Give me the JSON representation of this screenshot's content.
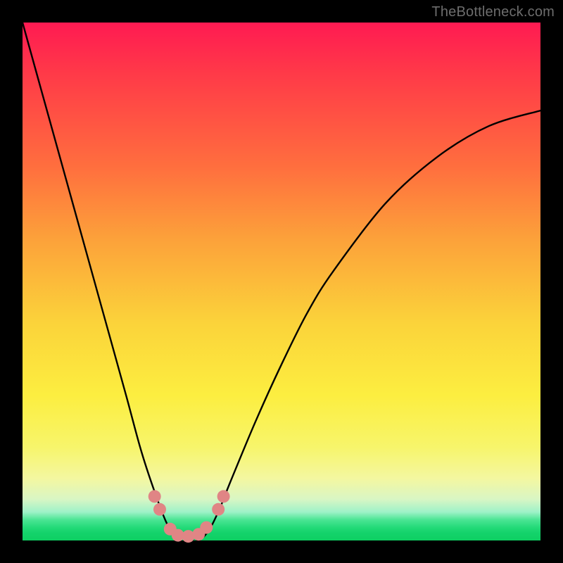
{
  "watermark": "TheBottleneck.com",
  "chart_data": {
    "type": "line",
    "title": "",
    "xlabel": "",
    "ylabel": "",
    "xlim": [
      0,
      1
    ],
    "ylim": [
      0,
      1
    ],
    "series": [
      {
        "name": "bottleneck-curve",
        "x": [
          0.0,
          0.05,
          0.1,
          0.15,
          0.2,
          0.23,
          0.26,
          0.28,
          0.3,
          0.32,
          0.34,
          0.36,
          0.38,
          0.4,
          0.45,
          0.5,
          0.55,
          0.6,
          0.7,
          0.8,
          0.9,
          1.0
        ],
        "y": [
          1.0,
          0.82,
          0.64,
          0.46,
          0.28,
          0.17,
          0.08,
          0.03,
          0.0,
          0.0,
          0.0,
          0.02,
          0.06,
          0.11,
          0.23,
          0.34,
          0.44,
          0.52,
          0.65,
          0.74,
          0.8,
          0.83
        ]
      }
    ],
    "markers": [
      {
        "x": 0.255,
        "y": 0.085
      },
      {
        "x": 0.265,
        "y": 0.06
      },
      {
        "x": 0.285,
        "y": 0.022
      },
      {
        "x": 0.3,
        "y": 0.01
      },
      {
        "x": 0.32,
        "y": 0.008
      },
      {
        "x": 0.34,
        "y": 0.012
      },
      {
        "x": 0.355,
        "y": 0.025
      },
      {
        "x": 0.378,
        "y": 0.06
      },
      {
        "x": 0.388,
        "y": 0.085
      }
    ],
    "background_bands": [
      {
        "from": 0.0,
        "to": 0.1,
        "color": "#ff1a52"
      },
      {
        "from": 0.1,
        "to": 0.28,
        "color": "#ff6f3e"
      },
      {
        "from": 0.28,
        "to": 0.58,
        "color": "#fca23a"
      },
      {
        "from": 0.58,
        "to": 0.82,
        "color": "#fcee40"
      },
      {
        "from": 0.82,
        "to": 0.94,
        "color": "#f4f7a0"
      },
      {
        "from": 0.94,
        "to": 1.0,
        "color": "#14d36b"
      }
    ],
    "colors": {
      "curve": "#000000",
      "marker": "#e08585",
      "frame": "#000000"
    }
  }
}
